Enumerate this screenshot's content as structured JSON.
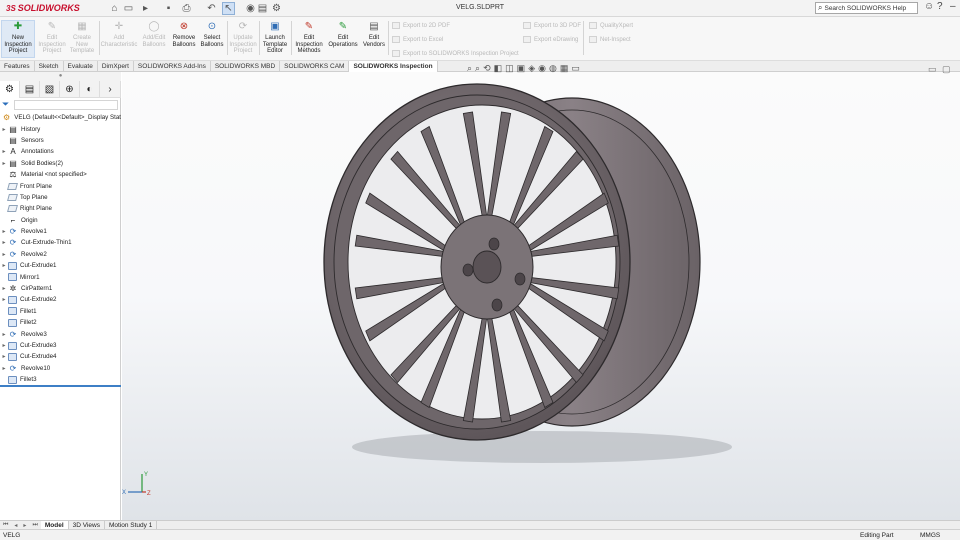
{
  "app": {
    "logo_prefix": "3S",
    "logo": "SOLIDWORKS",
    "document_title": "VELG.SLDPRT"
  },
  "search": {
    "placeholder": "Search SOLIDWORKS Help"
  },
  "toolbar": {
    "commands": [
      {
        "label": "New Inspection Project",
        "icon": "new-inspection-icon",
        "enabled": true
      },
      {
        "label": "Edit Inspection Project",
        "icon": "edit-project-icon",
        "enabled": false
      },
      {
        "label": "Create New Template",
        "icon": "template-icon",
        "enabled": false
      },
      {
        "label": "Add Characteristic",
        "icon": "add-characteristic-icon",
        "enabled": false
      },
      {
        "label": "Add/Edit Balloons",
        "icon": "balloon-icon",
        "enabled": false
      },
      {
        "label": "Remove Balloons",
        "icon": "remove-balloon-icon",
        "enabled": true
      },
      {
        "label": "Select Balloons",
        "icon": "select-balloon-icon",
        "enabled": true
      },
      {
        "label": "Update Inspection Project",
        "icon": "update-icon",
        "enabled": false
      },
      {
        "label": "Launch Template Editor",
        "icon": "launch-editor-icon",
        "enabled": true
      },
      {
        "label": "Edit Inspection Methods",
        "icon": "methods-icon",
        "enabled": true
      },
      {
        "label": "Edit Operations",
        "icon": "operations-icon",
        "enabled": true
      },
      {
        "label": "Edit Vendors",
        "icon": "vendors-icon",
        "enabled": true
      }
    ],
    "export_menu": [
      "Export to 2D PDF",
      "Export to Excel",
      "Export to SOLIDWORKS Inspection Project",
      "Export to 3D PDF",
      "Export eDrawing",
      "QualityXpert",
      "Net-Inspect"
    ]
  },
  "tabs": [
    "Features",
    "Sketch",
    "Evaluate",
    "DimXpert",
    "SOLIDWORKS Add-Ins",
    "SOLIDWORKS MBD",
    "SOLIDWORKS CAM",
    "SOLIDWORKS Inspection"
  ],
  "active_tab": "SOLIDWORKS Inspection",
  "tree": {
    "root": "VELG  (Default<<Default>_Display Stat",
    "items": [
      {
        "label": "History",
        "type": "folder",
        "expand": true
      },
      {
        "label": "Sensors",
        "type": "folder",
        "expand": false
      },
      {
        "label": "Annotations",
        "type": "annotation",
        "expand": true
      },
      {
        "label": "Solid Bodies(2)",
        "type": "folder",
        "expand": true
      },
      {
        "label": "Material <not specified>",
        "type": "material",
        "expand": false
      },
      {
        "label": "Front Plane",
        "type": "plane",
        "expand": false
      },
      {
        "label": "Top Plane",
        "type": "plane",
        "expand": false
      },
      {
        "label": "Right Plane",
        "type": "plane",
        "expand": false
      },
      {
        "label": "Origin",
        "type": "origin",
        "expand": false
      },
      {
        "label": "Revolve1",
        "type": "revolve",
        "expand": true
      },
      {
        "label": "Cut-Extrude-Thin1",
        "type": "revolve",
        "expand": true
      },
      {
        "label": "Revolve2",
        "type": "revolve",
        "expand": true
      },
      {
        "label": "Cut-Extrude1",
        "type": "feature",
        "expand": true
      },
      {
        "label": "Mirror1",
        "type": "feature",
        "expand": false
      },
      {
        "label": "CirPattern1",
        "type": "pattern",
        "expand": true
      },
      {
        "label": "Cut-Extrude2",
        "type": "feature",
        "expand": true
      },
      {
        "label": "Fillet1",
        "type": "feature",
        "expand": false
      },
      {
        "label": "Fillet2",
        "type": "feature",
        "expand": false
      },
      {
        "label": "Revolve3",
        "type": "revolve",
        "expand": true
      },
      {
        "label": "Cut-Extrude3",
        "type": "feature",
        "expand": true
      },
      {
        "label": "Cut-Extrude4",
        "type": "feature",
        "expand": true
      },
      {
        "label": "Revolve10",
        "type": "revolve",
        "expand": true
      },
      {
        "label": "Fillet3",
        "type": "feature",
        "expand": false
      }
    ]
  },
  "bottom_tabs": [
    "Model",
    "3D Views",
    "Motion Study 1"
  ],
  "status": {
    "doc": "VELG",
    "mode": "Editing Part",
    "units": "MMGS"
  },
  "triad": {
    "x": "X",
    "y": "Y",
    "z": "Z"
  }
}
